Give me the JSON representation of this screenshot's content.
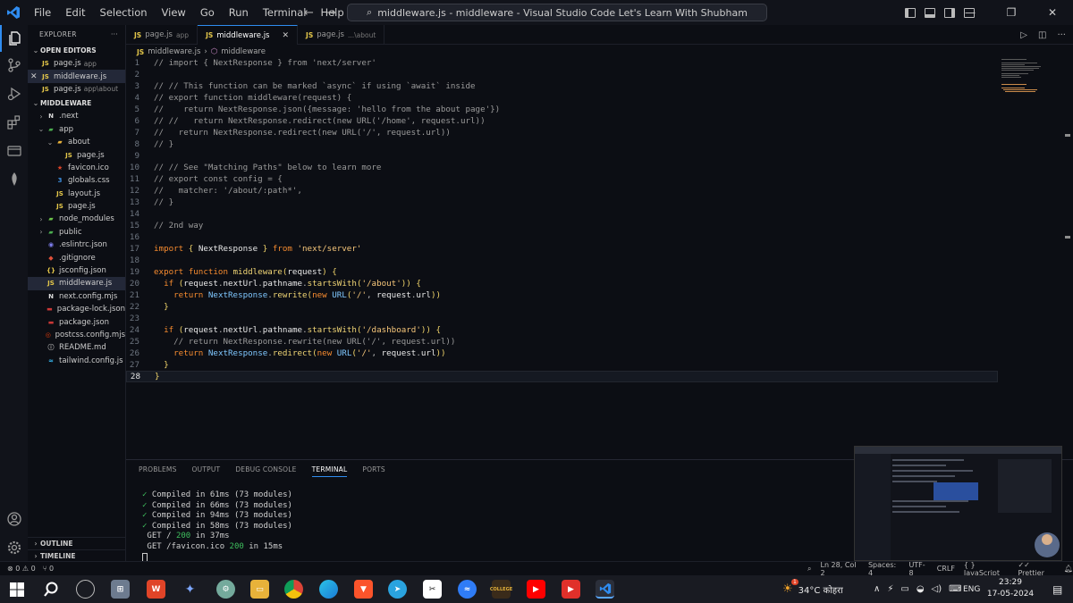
{
  "titlebar": {
    "menu": [
      "File",
      "Edit",
      "Selection",
      "View",
      "Go",
      "Run",
      "Terminal",
      "Help"
    ],
    "search_text": "middleware.js - middleware - Visual Studio Code Let's Learn With Shubham"
  },
  "sidebar": {
    "title": "EXPLORER",
    "open_editors_label": "OPEN EDITORS",
    "open_editors": [
      {
        "name": "page.js",
        "hint": "app"
      },
      {
        "name": "middleware.js",
        "hint": ""
      },
      {
        "name": "page.js",
        "hint": "app\\about"
      }
    ],
    "project_label": "MIDDLEWARE",
    "tree": [
      {
        "name": ".next",
        "type": "folder",
        "depth": 0,
        "icon": "next-icon"
      },
      {
        "name": "app",
        "type": "folder-open",
        "depth": 0,
        "icon": "app-folder-icon"
      },
      {
        "name": "about",
        "type": "folder-open",
        "depth": 1,
        "icon": "folder-icon"
      },
      {
        "name": "page.js",
        "type": "file",
        "depth": 2,
        "icon": "js-icon"
      },
      {
        "name": "favicon.ico",
        "type": "file",
        "depth": 1,
        "icon": "star-icon"
      },
      {
        "name": "globals.css",
        "type": "file",
        "depth": 1,
        "icon": "css-icon"
      },
      {
        "name": "layout.js",
        "type": "file",
        "depth": 1,
        "icon": "js-icon"
      },
      {
        "name": "page.js",
        "type": "file",
        "depth": 1,
        "icon": "js-icon"
      },
      {
        "name": "node_modules",
        "type": "folder",
        "depth": 0,
        "icon": "node-folder-icon"
      },
      {
        "name": "public",
        "type": "folder",
        "depth": 0,
        "icon": "public-folder-icon"
      },
      {
        "name": ".eslintrc.json",
        "type": "file",
        "depth": 0,
        "icon": "eslint-icon"
      },
      {
        "name": ".gitignore",
        "type": "file",
        "depth": 0,
        "icon": "git-icon"
      },
      {
        "name": "jsconfig.json",
        "type": "file",
        "depth": 0,
        "icon": "json-icon"
      },
      {
        "name": "middleware.js",
        "type": "file",
        "depth": 0,
        "icon": "js-icon"
      },
      {
        "name": "next.config.mjs",
        "type": "file",
        "depth": 0,
        "icon": "next-icon"
      },
      {
        "name": "package-lock.json",
        "type": "file",
        "depth": 0,
        "icon": "npm-icon"
      },
      {
        "name": "package.json",
        "type": "file",
        "depth": 0,
        "icon": "npm-icon"
      },
      {
        "name": "postcss.config.mjs",
        "type": "file",
        "depth": 0,
        "icon": "postcss-icon"
      },
      {
        "name": "README.md",
        "type": "file",
        "depth": 0,
        "icon": "readme-icon"
      },
      {
        "name": "tailwind.config.js",
        "type": "file",
        "depth": 0,
        "icon": "tailwind-icon"
      }
    ],
    "outline_label": "OUTLINE",
    "timeline_label": "TIMELINE"
  },
  "tabs": [
    {
      "name": "page.js",
      "hint": "app",
      "active": false
    },
    {
      "name": "middleware.js",
      "hint": "",
      "active": true
    },
    {
      "name": "page.js",
      "hint": "...\\about",
      "active": false
    }
  ],
  "breadcrumb": {
    "file": "middleware.js",
    "symbol": "middleware"
  },
  "editor": {
    "current_line": 28,
    "lines": [
      [
        [
          "cm",
          "// import { NextResponse } from 'next/server'"
        ]
      ],
      [],
      [
        [
          "cm",
          "// // This function can be marked `async` if using `await` inside"
        ]
      ],
      [
        [
          "cm",
          "// export function middleware(request) {"
        ]
      ],
      [
        [
          "cm",
          "//    return NextResponse.json({message: 'hello from the about page'})"
        ]
      ],
      [
        [
          "cm",
          "// //   return NextResponse.redirect(new URL('/home', request.url))"
        ]
      ],
      [
        [
          "cm",
          "//   return NextResponse.redirect(new URL('/', request.url))"
        ]
      ],
      [
        [
          "cm",
          "// }"
        ]
      ],
      [],
      [
        [
          "cm",
          "// // See \"Matching Paths\" below to learn more"
        ]
      ],
      [
        [
          "cm",
          "// export const config = {"
        ]
      ],
      [
        [
          "cm",
          "//   matcher: '/about/:path*',"
        ]
      ],
      [
        [
          "cm",
          "// }"
        ]
      ],
      [],
      [
        [
          "cm",
          "// 2nd way"
        ]
      ],
      [],
      [
        [
          "kw",
          "import "
        ],
        [
          "pn",
          "{ "
        ],
        [
          "id",
          "NextResponse "
        ],
        [
          "pn",
          "} "
        ],
        [
          "kw",
          "from "
        ],
        [
          "str",
          "'next/server'"
        ]
      ],
      [],
      [
        [
          "kw",
          "export function "
        ],
        [
          "fn",
          "middleware"
        ],
        [
          "pn",
          "("
        ],
        [
          "id",
          "request"
        ],
        [
          "pn",
          ") {"
        ]
      ],
      [
        [
          "ind",
          "  "
        ],
        [
          "kw",
          "if "
        ],
        [
          "pn",
          "("
        ],
        [
          "id",
          "request"
        ],
        [
          "code",
          "."
        ],
        [
          "id",
          "nextUrl"
        ],
        [
          "code",
          "."
        ],
        [
          "id",
          "pathname"
        ],
        [
          "code",
          "."
        ],
        [
          "fn",
          "startsWith"
        ],
        [
          "pn",
          "("
        ],
        [
          "str",
          "'/about'"
        ],
        [
          "pn",
          ")) {"
        ]
      ],
      [
        [
          "ind",
          "    "
        ],
        [
          "kw",
          "return "
        ],
        [
          "cls",
          "NextResponse"
        ],
        [
          "code",
          "."
        ],
        [
          "fn",
          "rewrite"
        ],
        [
          "pn",
          "("
        ],
        [
          "kw",
          "new "
        ],
        [
          "cls",
          "URL"
        ],
        [
          "pn",
          "("
        ],
        [
          "str",
          "'/'"
        ],
        [
          "code",
          ", "
        ],
        [
          "id",
          "request"
        ],
        [
          "code",
          "."
        ],
        [
          "id",
          "url"
        ],
        [
          "pn",
          "))"
        ]
      ],
      [
        [
          "ind",
          "  "
        ],
        [
          "pn",
          "}"
        ]
      ],
      [],
      [
        [
          "ind",
          "  "
        ],
        [
          "kw",
          "if "
        ],
        [
          "pn",
          "("
        ],
        [
          "id",
          "request"
        ],
        [
          "code",
          "."
        ],
        [
          "id",
          "nextUrl"
        ],
        [
          "code",
          "."
        ],
        [
          "id",
          "pathname"
        ],
        [
          "code",
          "."
        ],
        [
          "fn",
          "startsWith"
        ],
        [
          "pn",
          "("
        ],
        [
          "str",
          "'/dashboard'"
        ],
        [
          "pn",
          ")) {"
        ]
      ],
      [
        [
          "ind",
          "    "
        ],
        [
          "cm",
          "// return NextResponse.rewrite(new URL('/', request.url))"
        ]
      ],
      [
        [
          "ind",
          "    "
        ],
        [
          "kw",
          "return "
        ],
        [
          "cls",
          "NextResponse"
        ],
        [
          "code",
          "."
        ],
        [
          "fn",
          "redirect"
        ],
        [
          "pn",
          "("
        ],
        [
          "kw",
          "new "
        ],
        [
          "cls",
          "URL"
        ],
        [
          "pn",
          "("
        ],
        [
          "str",
          "'/'"
        ],
        [
          "code",
          ", "
        ],
        [
          "id",
          "request"
        ],
        [
          "code",
          "."
        ],
        [
          "id",
          "url"
        ],
        [
          "pn",
          "))"
        ]
      ],
      [
        [
          "ind",
          "  "
        ],
        [
          "pn",
          "}"
        ]
      ],
      [
        [
          "pn",
          "}"
        ]
      ]
    ]
  },
  "panel": {
    "tabs": [
      "PROBLEMS",
      "OUTPUT",
      "DEBUG CONSOLE",
      "TERMINAL",
      "PORTS"
    ],
    "active_tab": "TERMINAL",
    "terminal": [
      {
        "check": true,
        "text": "Compiled in 61ms (73 modules)"
      },
      {
        "check": true,
        "text": "Compiled in 66ms (73 modules)"
      },
      {
        "check": true,
        "text": "Compiled in 94ms (73 modules)"
      },
      {
        "check": true,
        "text": "Compiled in 58ms (73 modules)"
      },
      {
        "check": false,
        "pre": "GET / ",
        "code": "200",
        "post": " in 37ms"
      },
      {
        "check": false,
        "pre": "GET /favicon.ico ",
        "code": "200",
        "post": " in 15ms"
      }
    ]
  },
  "statusbar": {
    "errors": "0",
    "warnings": "0",
    "ports": "0",
    "position": "Ln 28, Col 2",
    "spaces": "Spaces: 4",
    "encoding": "UTF-8",
    "eol": "CRLF",
    "language": "JavaScript",
    "formatter": "Prettier"
  },
  "taskbar": {
    "weather": "34°C  कोहरा",
    "language": "ENG",
    "time": "23:29",
    "date": "17-05-2024",
    "notification_count": "1"
  }
}
